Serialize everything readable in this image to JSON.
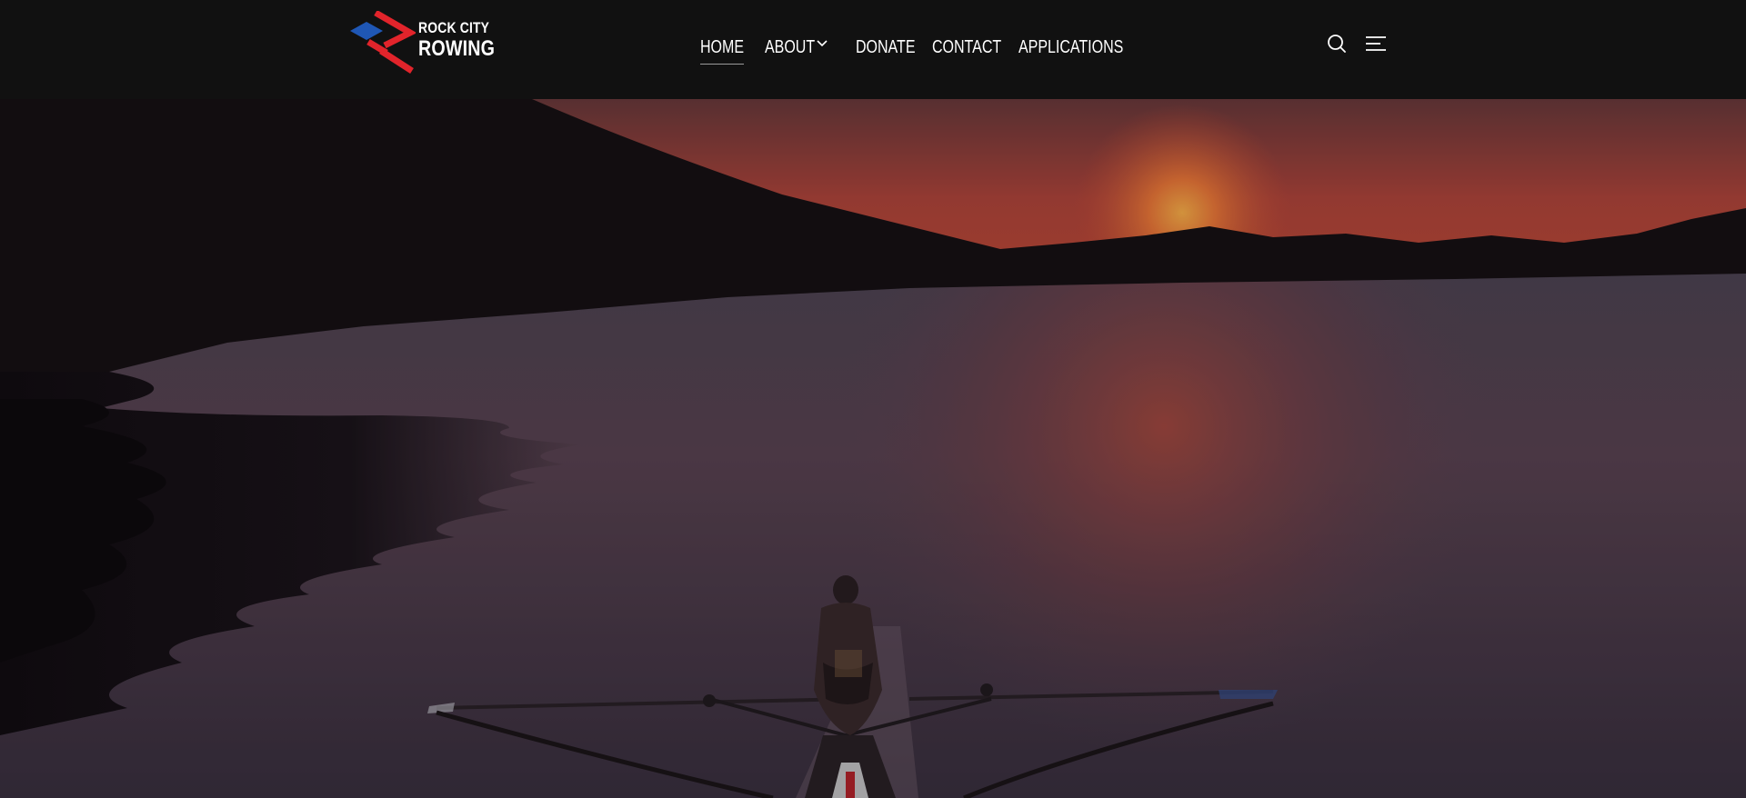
{
  "site": {
    "logo": {
      "line1": "ROCK CITY",
      "line2": "ROWING",
      "colors": {
        "blue": "#1f57b5",
        "red": "#e2242b"
      }
    }
  },
  "nav": {
    "items": [
      {
        "label": "HOME",
        "active": true
      },
      {
        "label": "ABOUT",
        "has_dropdown": true
      },
      {
        "label": "DONATE"
      },
      {
        "label": "CONTACT"
      },
      {
        "label": "APPLICATIONS"
      }
    ]
  },
  "header_icons": {
    "search": "search-icon",
    "menu": "menu-lines-icon"
  },
  "hero": {
    "background": "video-background",
    "scene": "rower-single-scull-at-sunset"
  }
}
